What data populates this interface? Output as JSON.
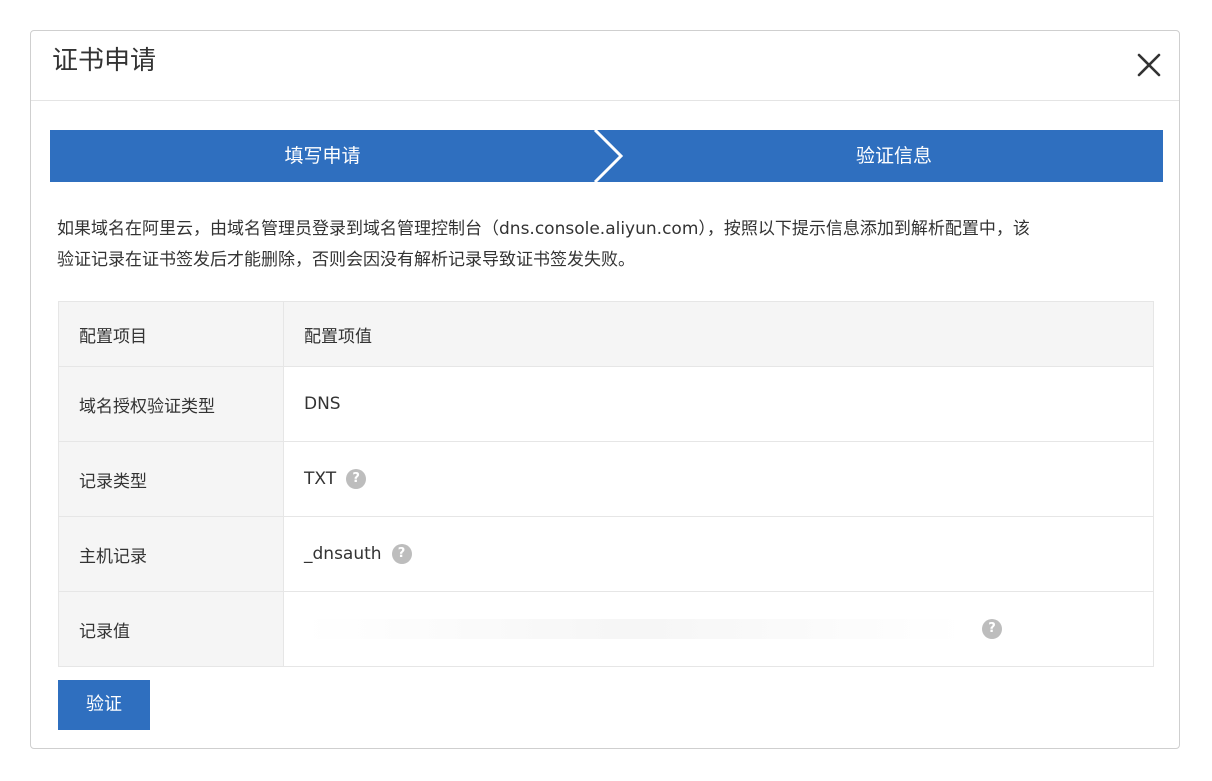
{
  "dialog": {
    "title": "证书申请",
    "close_icon": "close-icon"
  },
  "steps": [
    {
      "label": "填写申请",
      "state": "active"
    },
    {
      "label": "验证信息",
      "state": "active"
    }
  ],
  "colors": {
    "step_bg": "#2f6fbf",
    "step_text": "#ffffff",
    "button_bg": "#2f6fbf",
    "table_header_bg": "#f5f5f5",
    "help_icon": "#bdbdbd"
  },
  "notice": {
    "line1": "如果域名在阿里云，由域名管理员登录到域名管理控制台（dns.console.aliyun.com），按照以下提示信息添加到解析配置中，该",
    "line2": "验证记录在证书签发后才能删除，否则会因没有解析记录导致证书签发失败。"
  },
  "table": {
    "headers": [
      "配置项目",
      "配置项值"
    ],
    "rows": [
      {
        "key": "域名授权验证类型",
        "value": "DNS",
        "help": false
      },
      {
        "key": "记录类型",
        "value": "TXT",
        "help": true
      },
      {
        "key": "主机记录",
        "value": "_dnsauth",
        "help": true
      },
      {
        "key": "记录值",
        "value": "",
        "help": true
      }
    ]
  },
  "help_icon_glyph": "?",
  "verify_button": {
    "label": "验证"
  }
}
